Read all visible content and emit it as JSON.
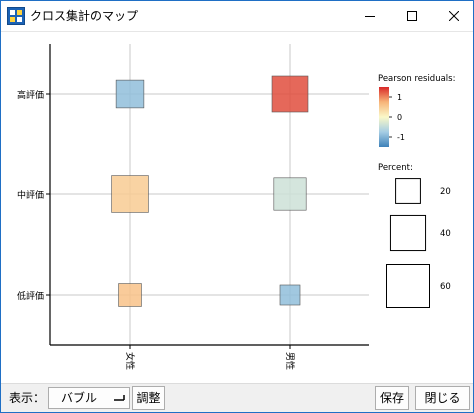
{
  "window": {
    "title": "クロス集計のマップ"
  },
  "chart_data": {
    "type": "bubble",
    "rows": [
      "高評価",
      "中評価",
      "低評価"
    ],
    "columns": [
      "女性",
      "男性"
    ],
    "cells": [
      {
        "row": "高評価",
        "column": "女性",
        "percent": 25,
        "residual": -0.9
      },
      {
        "row": "高評価",
        "column": "男性",
        "percent": 42,
        "residual": 1.3
      },
      {
        "row": "中評価",
        "column": "女性",
        "percent": 44,
        "residual": 0.5
      },
      {
        "row": "中評価",
        "column": "男性",
        "percent": 34,
        "residual": -0.4
      },
      {
        "row": "低評価",
        "column": "女性",
        "percent": 17,
        "residual": 0.6
      },
      {
        "row": "低評価",
        "column": "男性",
        "percent": 13,
        "residual": -0.9
      }
    ],
    "color_legend": {
      "title": "Pearson residuals:",
      "ticks": [
        "1",
        "0",
        "-1"
      ]
    },
    "size_legend": {
      "title": "Percent:",
      "values": [
        20,
        40,
        60
      ]
    }
  },
  "bottom": {
    "display_label": "表示：",
    "display_value": "バブル",
    "adjust_label": "調整",
    "save_label": "保存",
    "close_label": "閉じる"
  }
}
